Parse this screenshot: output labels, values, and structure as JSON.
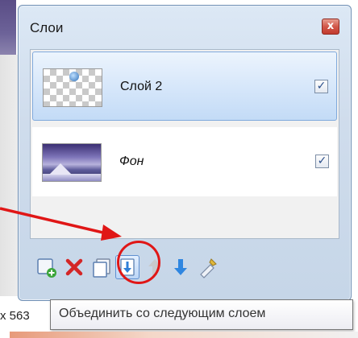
{
  "panel": {
    "title": "Слои",
    "close_glyph": "x"
  },
  "layers": [
    {
      "name": "Слой 2",
      "thumbnail": "transparent-layer",
      "visible": true,
      "selected": true,
      "check": "✓"
    },
    {
      "name": "Фон",
      "thumbnail": "background-landscape",
      "visible": true,
      "selected": false,
      "check": "✓"
    }
  ],
  "toolbar": {
    "icons": [
      "add-layer-icon",
      "delete-layer-icon",
      "duplicate-layer-icon",
      "merge-down-icon",
      "move-up-icon",
      "move-down-icon",
      "layer-properties-icon"
    ],
    "highlighted": "merge-down-icon"
  },
  "tooltip": {
    "text": "Объединить со следующим слоем"
  },
  "status": {
    "text": "x 563"
  },
  "annotation": {
    "color": "#e01616"
  }
}
